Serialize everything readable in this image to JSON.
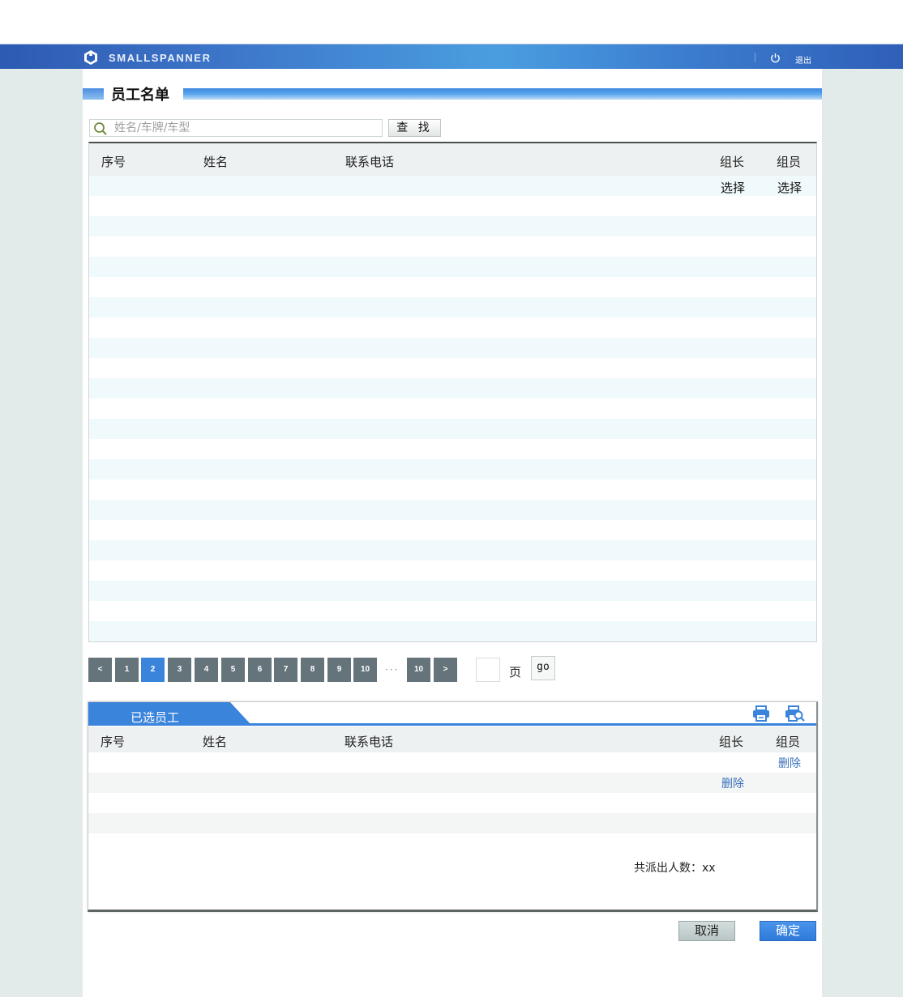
{
  "header": {
    "brand": "SMALLSPANNER",
    "logout_label": "退出"
  },
  "section": {
    "title": "员工名单"
  },
  "search": {
    "placeholder": "姓名/车牌/车型",
    "value": "",
    "button_label": "查 找"
  },
  "staff_table": {
    "columns": {
      "index": "序号",
      "name": "姓名",
      "phone": "联系电话",
      "leader": "组长",
      "member": "组员"
    },
    "rows": [
      {
        "leader_action": "选择",
        "member_action": "选择"
      }
    ],
    "empty_row_count": 22
  },
  "pagination": {
    "prev_label": "<",
    "next_label": ">",
    "pages": [
      "1",
      "2",
      "3",
      "4",
      "5",
      "6",
      "7",
      "8",
      "9",
      "10"
    ],
    "current_page": "2",
    "ellipsis": "···",
    "last_page": "10",
    "page_input_value": "",
    "page_suffix": "页",
    "go_label": "go"
  },
  "selected_panel": {
    "tab_label": "已选员工",
    "print_icon": "printer-icon",
    "preview_icon": "print-preview-icon",
    "columns": {
      "index": "序号",
      "name": "姓名",
      "phone": "联系电话",
      "leader": "组长",
      "member": "组员"
    },
    "rows": [
      {
        "leader_action": "",
        "member_action": "删除"
      },
      {
        "leader_action": "删除",
        "member_action": ""
      },
      {
        "leader_action": "",
        "member_action": ""
      },
      {
        "leader_action": "",
        "member_action": ""
      }
    ],
    "total_label": "共派出人数：xx"
  },
  "footer": {
    "cancel_label": "取消",
    "confirm_label": "确定"
  },
  "colors": {
    "accent": "#3a84dc",
    "pager_bg": "#65737a",
    "link": "#3a6fb8",
    "canvas": "#e2ebe9"
  }
}
